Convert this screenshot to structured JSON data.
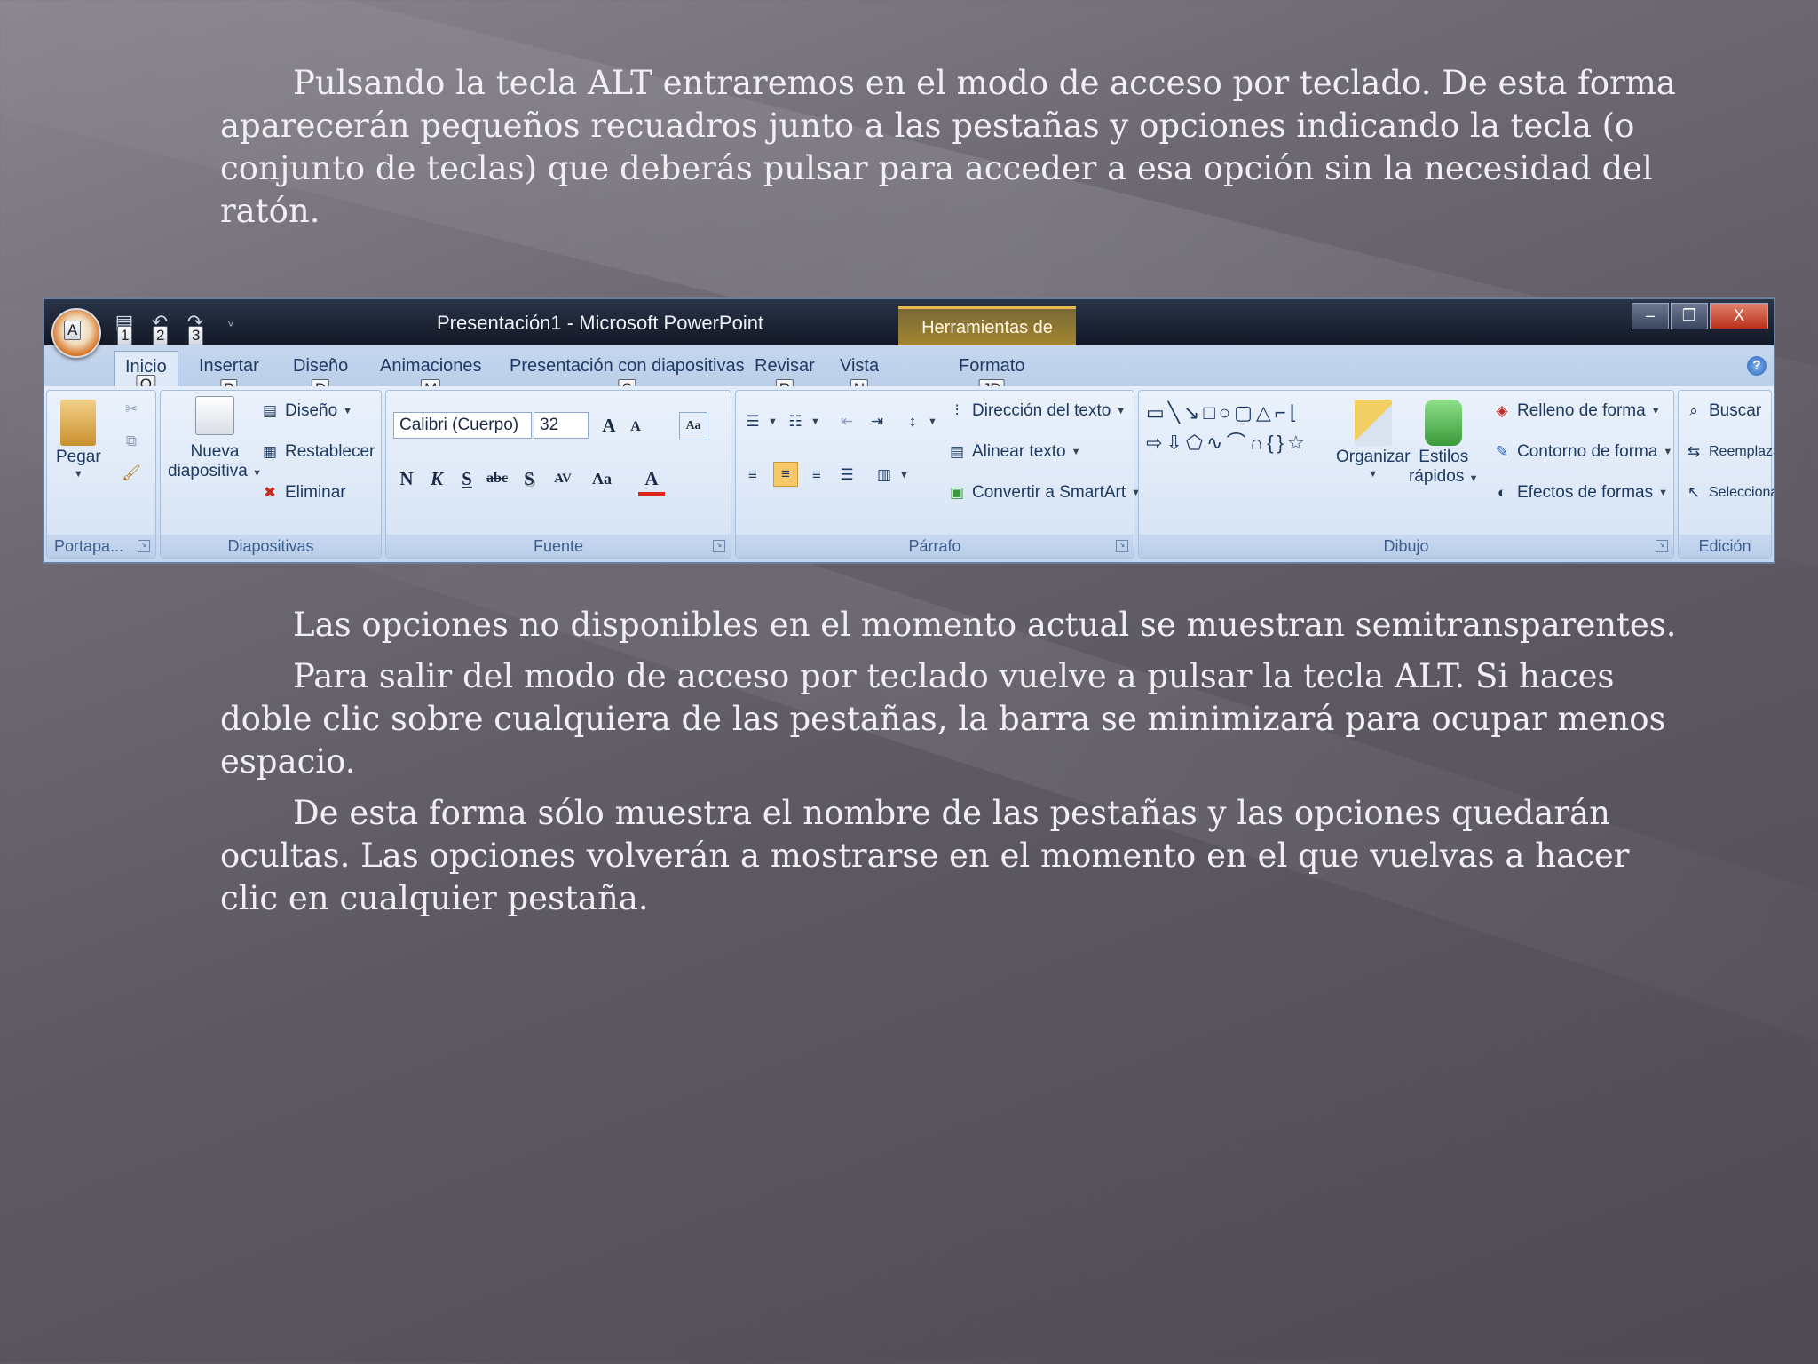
{
  "slide": {
    "para1": "Pulsando la tecla ALT entraremos en el modo de acceso por teclado. De esta forma aparecerán pequeños recuadros junto a las pestañas y opciones indicando la tecla (o conjunto de teclas) que deberás pulsar para acceder a esa opción sin la necesidad del ratón.",
    "para2": "Las opciones no disponibles en el momento actual se muestran semitransparentes.",
    "para3": "Para salir del modo de acceso por teclado vuelve a pulsar la tecla ALT. Si haces doble clic sobre cualquiera de las pestañas, la barra se minimizará para ocupar menos espacio.",
    "para4": "De esta forma sólo muestra el nombre de las pestañas y las opciones quedarán ocultas. Las opciones volverán a mostrarse en el momento en el que vuelvas a hacer clic en cualquier pestaña."
  },
  "window": {
    "title": "Presentación1 - Microsoft PowerPoint",
    "contextual_tools": "Herramientas de dibujo",
    "office_keytip": "A",
    "qat_keytips": [
      "1",
      "2",
      "3"
    ],
    "minimize": "–",
    "restore": "❐",
    "close": "X"
  },
  "tabs": [
    {
      "label": "Inicio",
      "keytip": "O"
    },
    {
      "label": "Insertar",
      "keytip": "B"
    },
    {
      "label": "Diseño",
      "keytip": "D"
    },
    {
      "label": "Animaciones",
      "keytip": "M"
    },
    {
      "label": "Presentación con diapositivas",
      "keytip": "S"
    },
    {
      "label": "Revisar",
      "keytip": "R"
    },
    {
      "label": "Vista",
      "keytip": "N"
    },
    {
      "label": "Formato",
      "keytip": "JD"
    }
  ],
  "groups": {
    "clipboard": {
      "label": "Portapa...",
      "paste": "Pegar"
    },
    "slides": {
      "label": "Diapositivas",
      "new_slide_1": "Nueva",
      "new_slide_2": "diapositiva",
      "layout": "Diseño",
      "reset": "Restablecer",
      "delete": "Eliminar"
    },
    "font": {
      "label": "Fuente",
      "font_name": "Calibri (Cuerpo)",
      "font_size": "32",
      "bold": "N",
      "italic": "K",
      "underline": "S",
      "strike": "abc",
      "shadow": "S",
      "spacing": "AV",
      "case": "Aa",
      "color": "A"
    },
    "paragraph": {
      "label": "Párrafo",
      "text_direction": "Dirección del texto",
      "align_text": "Alinear texto",
      "smartart": "Convertir a SmartArt"
    },
    "drawing": {
      "label": "Dibujo",
      "arrange": "Organizar",
      "quick_styles_1": "Estilos",
      "quick_styles_2": "rápidos",
      "shape_fill": "Relleno de forma",
      "shape_outline": "Contorno de forma",
      "shape_effects": "Efectos de formas"
    },
    "editing": {
      "label": "Edición",
      "find": "Buscar",
      "replace": "Reemplazar",
      "select": "Seleccionar"
    }
  },
  "colors": {
    "accent": "#d9772a",
    "ribbon": "#c9daf0",
    "font_color": "#e0231b"
  }
}
